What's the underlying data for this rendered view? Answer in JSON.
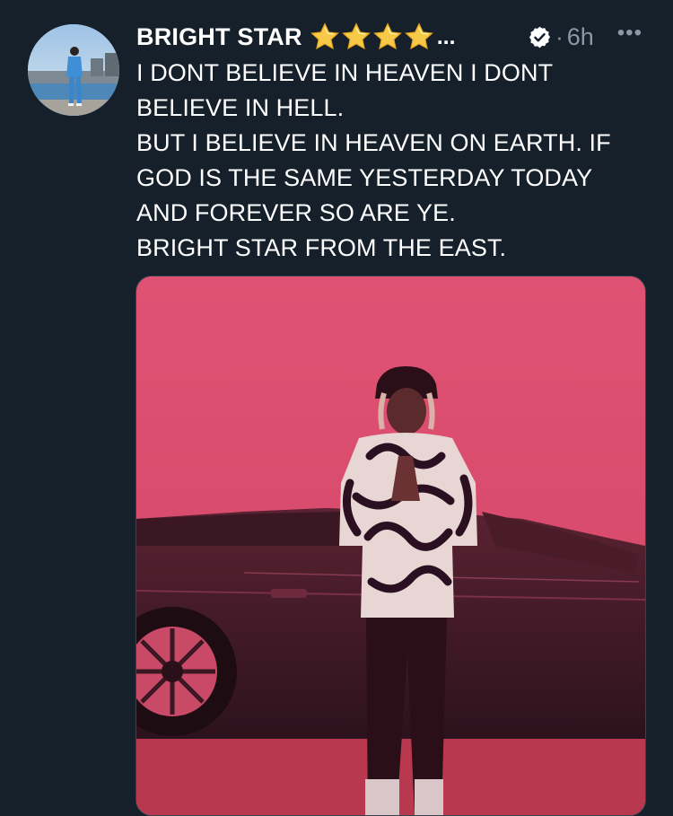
{
  "post": {
    "author_name": "BRIGHT STAR",
    "name_emoji": "star-emoji",
    "name_emoji_count": 4,
    "name_truncation": "...",
    "verified_icon": "verified-badge-icon",
    "time_separator": "·",
    "timestamp": "6h",
    "more_icon": "•••",
    "text_lines": [
      "I DONT BELIEVE IN HEAVEN I DONT",
      "BELIEVE IN HELL.",
      "BUT I BELIEVE IN HEAVEN ON EARTH. IF",
      "GOD IS THE SAME YESTERDAY TODAY",
      "AND FOREVER SO ARE YE.",
      "BRIGHT STAR FROM THE EAST."
    ]
  },
  "colors": {
    "background": "#15202b",
    "text": "#ffffff",
    "secondary_text": "#8b98a5",
    "photo_tint": "#d9476a"
  }
}
